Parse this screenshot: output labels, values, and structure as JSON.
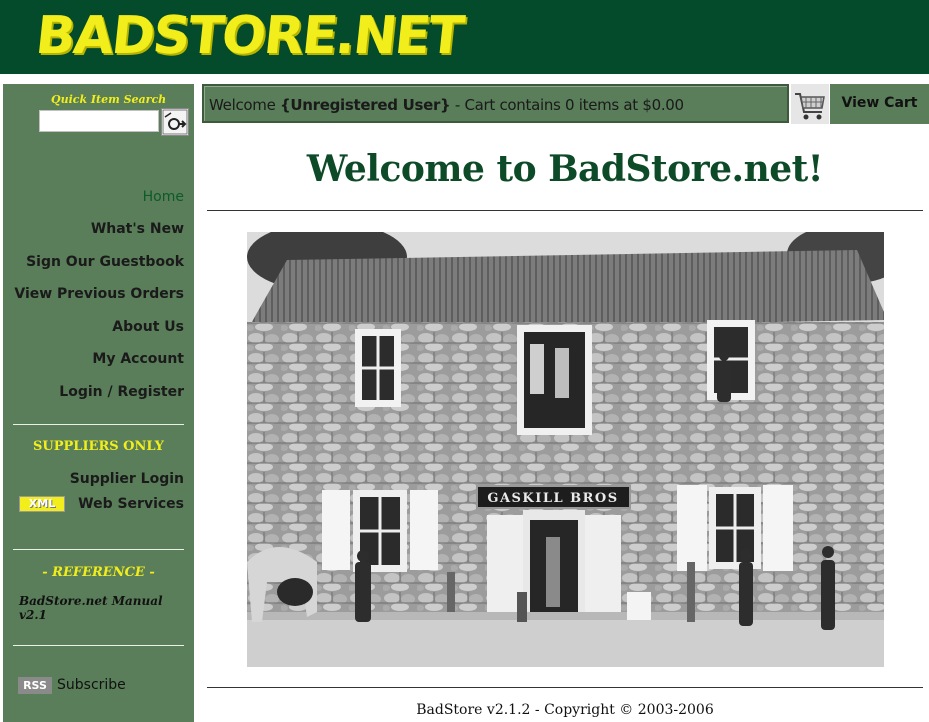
{
  "header": {
    "logo_text": "BADSTORE.NET"
  },
  "sidebar": {
    "search_label": "Quick Item Search",
    "search_value": "",
    "nav": [
      {
        "label": "Home",
        "active": true
      },
      {
        "label": "What's New"
      },
      {
        "label": "Sign Our Guestbook"
      },
      {
        "label": "View Previous Orders"
      },
      {
        "label": "About Us"
      },
      {
        "label": "My Account"
      },
      {
        "label": "Login / Register"
      }
    ],
    "suppliers_heading": "SUPPLIERS ONLY",
    "supplier_login": "Supplier Login",
    "xml_badge": "XML",
    "web_services": "Web Services",
    "reference_heading": "- REFERENCE -",
    "manual_link": "BadStore.net Manual v2.1",
    "rss_badge": "RSS",
    "rss_label": "Subscribe"
  },
  "welcome_bar": {
    "prefix": "Welcome ",
    "user": "{Unregistered User}",
    "suffix": " - Cart contains 0 items at $0.00",
    "view_cart": "View Cart"
  },
  "main": {
    "title": "Welcome to BadStore.net!",
    "sign_text": "GASKILL BROS"
  },
  "footer": {
    "text": "BadStore v2.1.2 - Copyright © 2003-2006"
  },
  "colors": {
    "header_bg": "#034b2b",
    "logo": "#f2ee1c",
    "sidebar_bg": "#5a7d5a",
    "title": "#0d4a28"
  }
}
